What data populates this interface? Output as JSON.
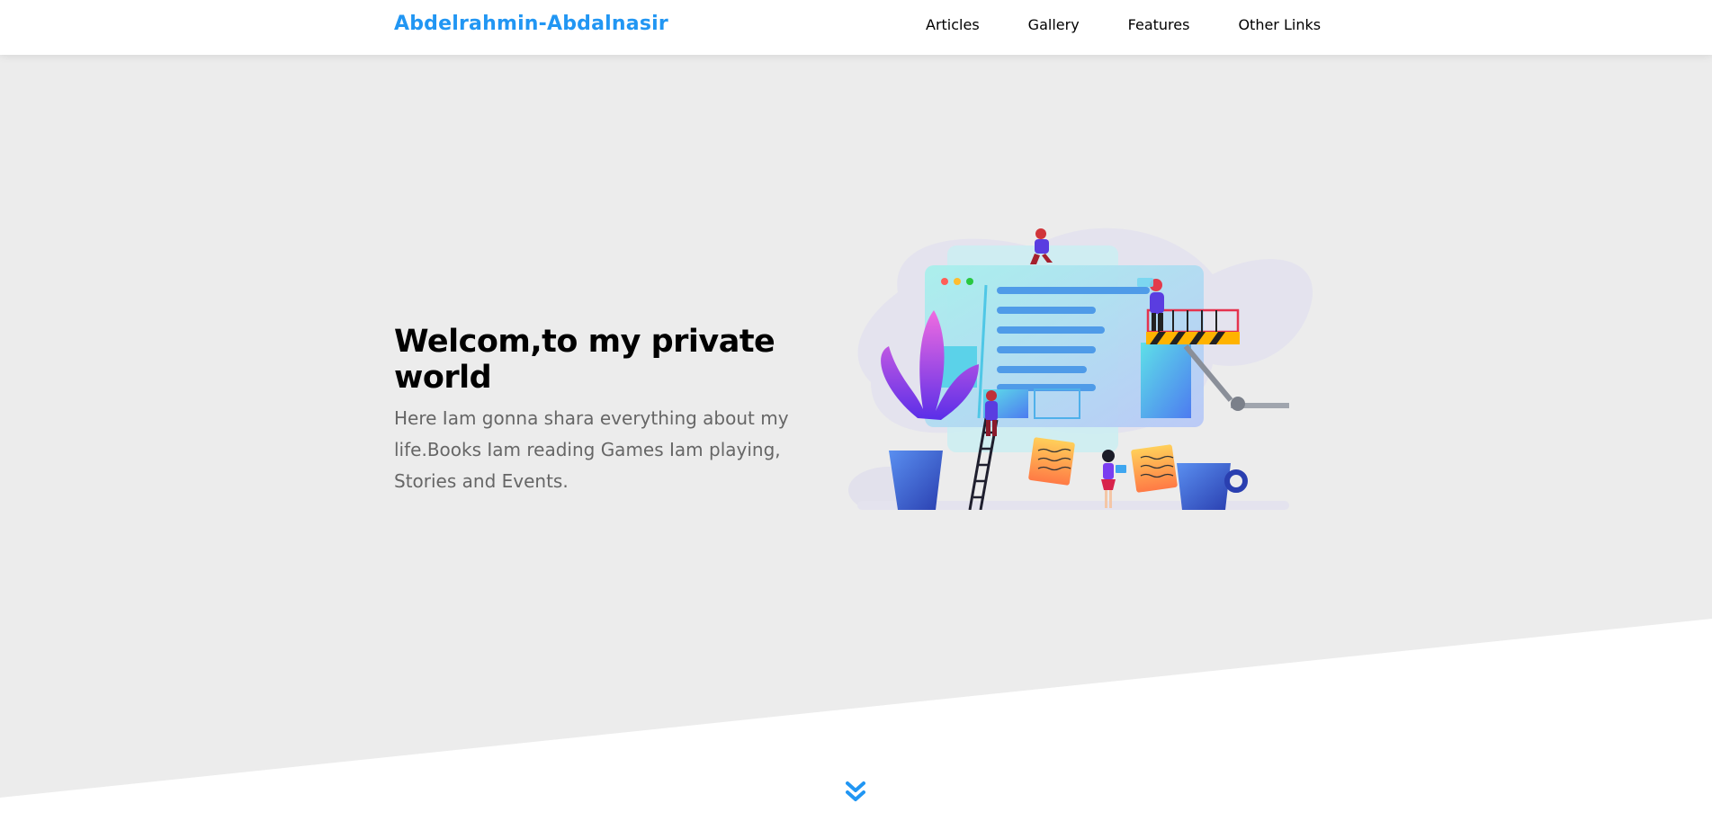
{
  "header": {
    "logo": "Abdelrahmin-Abdalnasir",
    "nav": [
      {
        "label": "Articles"
      },
      {
        "label": "Gallery"
      },
      {
        "label": "Features"
      },
      {
        "label": "Other Links"
      }
    ]
  },
  "landing": {
    "title": "Welcom,to my private world",
    "description": "Here Iam gonna shara everything about my life.Books Iam reading Games Iam playing, Stories and Events.",
    "illustration": "web-building-team-illustration",
    "go_down_icon": "double-chevron-down-icon"
  },
  "colors": {
    "accent": "#2196f3",
    "landing_bg": "#ececec",
    "text_muted": "#666666"
  }
}
